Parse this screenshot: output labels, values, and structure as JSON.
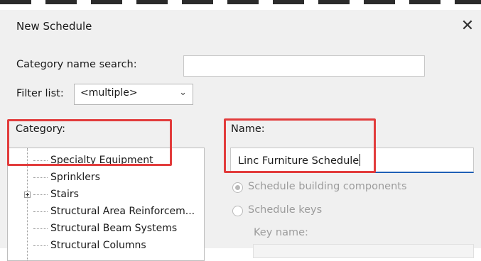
{
  "window": {
    "title": "New Schedule",
    "close_symbol": "✕"
  },
  "category_search": {
    "label": "Category name search:",
    "value": ""
  },
  "filter_list": {
    "label": "Filter list:",
    "selected": "<multiple>"
  },
  "category": {
    "label": "Category:",
    "items": [
      "Specialty Equipment",
      "Sprinklers",
      "Stairs",
      "Structural Area Reinforcem...",
      "Structural Beam Systems",
      "Structural Columns"
    ]
  },
  "name": {
    "label": "Name:",
    "value": "Linc Furniture Schedule"
  },
  "options": {
    "schedule_building_components": "Schedule building components",
    "schedule_keys": "Schedule keys",
    "key_name_label": "Key name:"
  },
  "colors": {
    "highlight": "#e23c3c",
    "focus_underline": "#1f5fb5"
  }
}
